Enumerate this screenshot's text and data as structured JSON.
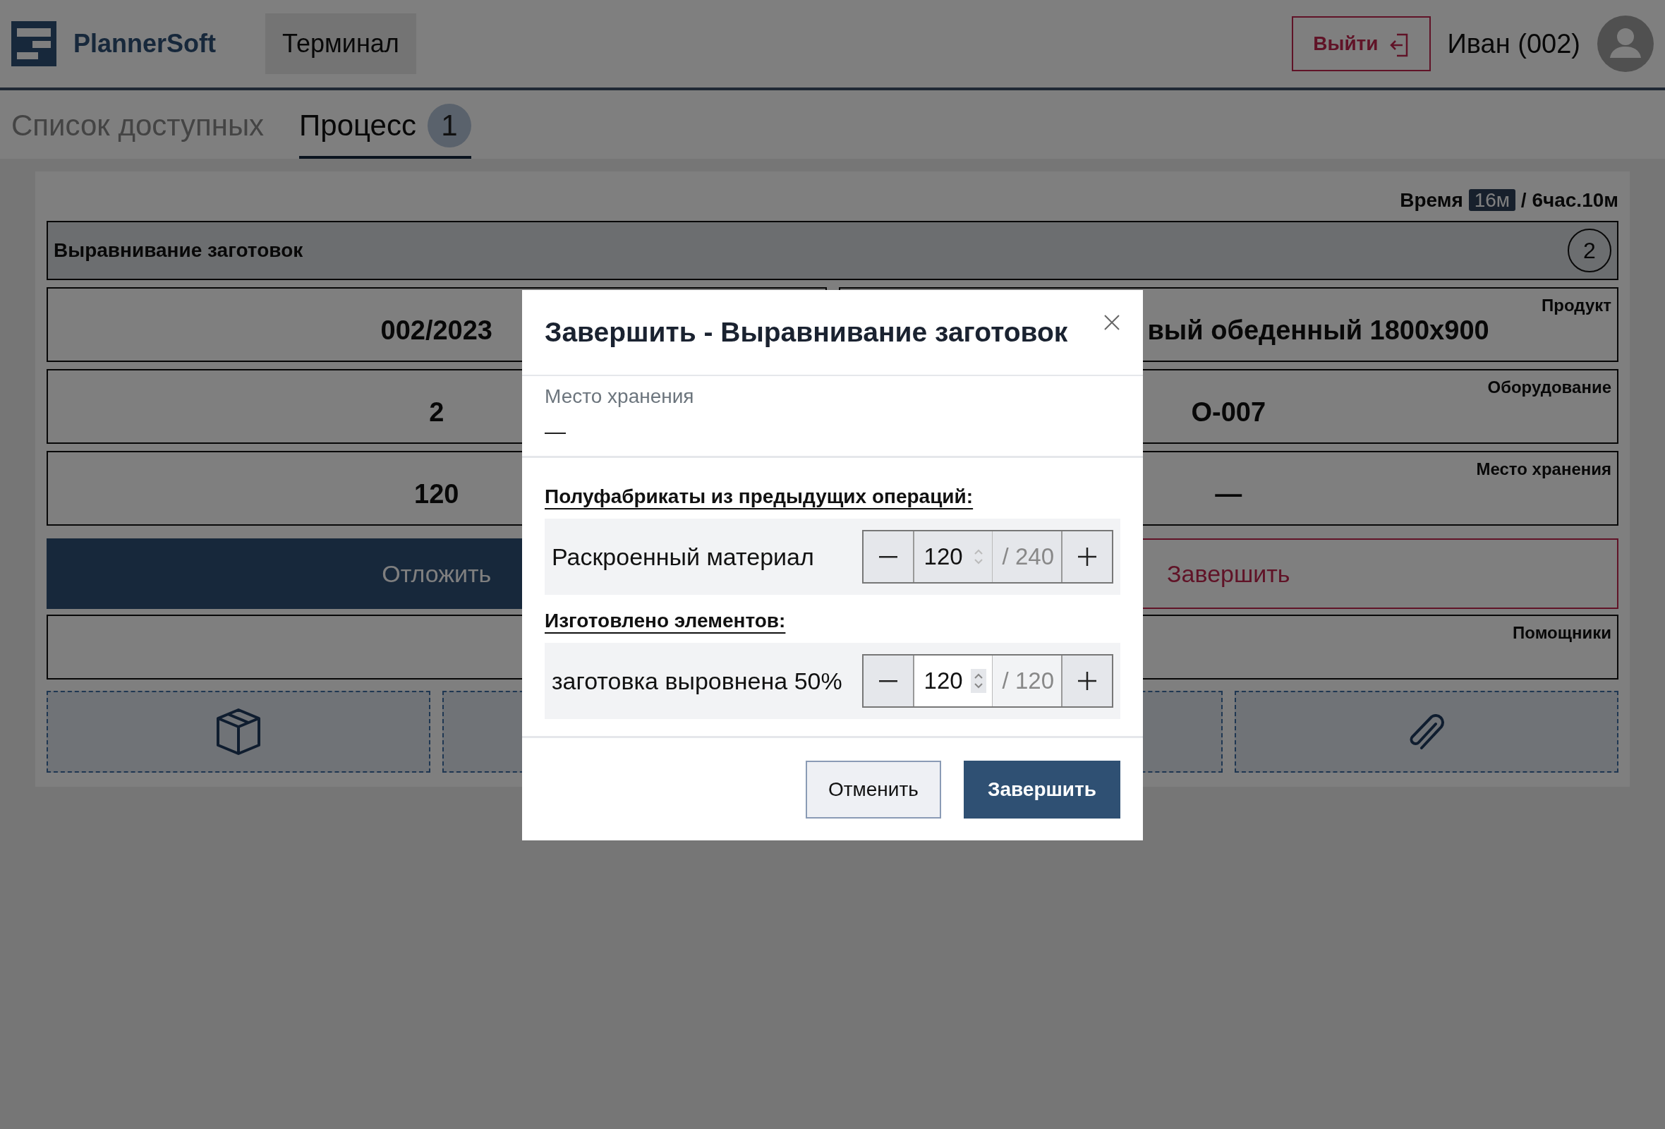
{
  "header": {
    "brand": "PlannerSoft",
    "terminal_button": "Терминал",
    "logout_button": "Выйти",
    "user_name": "Иван (002)"
  },
  "tabs": [
    {
      "label": "Список доступных",
      "selected": false
    },
    {
      "label": "Процесс",
      "selected": true,
      "badge": "1"
    }
  ],
  "task": {
    "time_label": "Время",
    "time_elapsed": "16м",
    "time_total": "/ 6час.10м",
    "operation": "Выравнивание заготовок",
    "operation_count": "2",
    "fields": [
      {
        "value": "002/2023"
      },
      {
        "label": "Продукт",
        "value": "вый обеденный 1800x900"
      },
      {
        "value": "2"
      },
      {
        "label": "Оборудование",
        "value": "О-007"
      },
      {
        "value": "120"
      },
      {
        "label": "Место хранения",
        "value": "—"
      }
    ],
    "postpone_button": "Отложить",
    "finish_button": "Завершить",
    "helpers_label": "Помощники",
    "tiles": [
      {
        "kind": "box"
      },
      {
        "kind": "blank"
      },
      {
        "kind": "blank"
      },
      {
        "kind": "paperclip"
      }
    ]
  },
  "modal": {
    "title": "Завершить - Выравнивание заготовок",
    "storage_label": "Место хранения",
    "storage_value": "—",
    "groups": [
      {
        "heading": "Полуфабрикаты из предыдущих операций:",
        "items": [
          {
            "name": "Раскроенный материал",
            "value": "120",
            "total": "/ 240",
            "disabled": true
          }
        ]
      },
      {
        "heading": "Изготовлено элементов:",
        "items": [
          {
            "name": "заготовка выровнена 50%",
            "value": "120",
            "total": "/ 120",
            "disabled": false
          }
        ]
      }
    ],
    "cancel_button": "Отменить",
    "confirm_button": "Завершить"
  }
}
